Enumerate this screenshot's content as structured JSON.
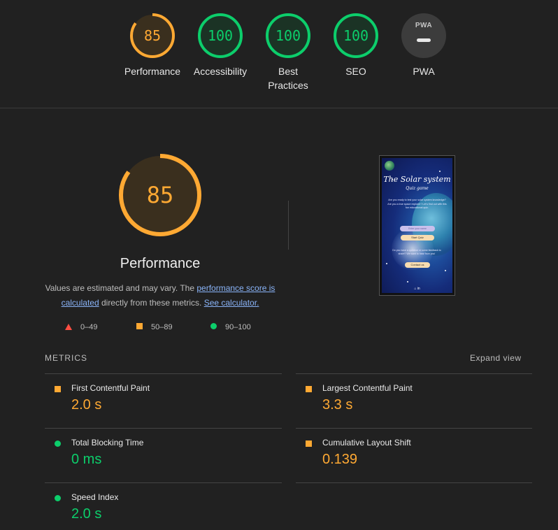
{
  "colors": {
    "background": "#212121",
    "average": "#ffa933",
    "pass": "#0cce6b",
    "fail": "#ff4e42",
    "link": "#8ab4f8"
  },
  "categories": [
    {
      "label": "Performance",
      "score": "85",
      "status": "average"
    },
    {
      "label": "Accessibility",
      "score": "100",
      "status": "pass"
    },
    {
      "label": "Best Practices",
      "score": "100",
      "status": "pass"
    },
    {
      "label": "SEO",
      "score": "100",
      "status": "pass"
    },
    {
      "label": "PWA",
      "score": "",
      "status": "na"
    }
  ],
  "pwa_badge": "PWA",
  "performance": {
    "score": "85",
    "title": "Performance",
    "desc_prefix": "Values are estimated and may vary. The ",
    "desc_link1": "performance score is calculated",
    "desc_middle": " directly from these metrics. ",
    "desc_link2": "See calculator."
  },
  "legend": [
    {
      "icon": "triangle",
      "range": "0–49"
    },
    {
      "icon": "square",
      "range": "50–89"
    },
    {
      "icon": "circle",
      "range": "90–100"
    }
  ],
  "screenshot": {
    "title": "The Solar system",
    "subtitle": "Quiz game",
    "text1": "Are you ready to test your solar system knowledge? Are you a true space explorer? Let's find out with this fun educational quiz.",
    "input_placeholder": "Enter your name",
    "start_button": "Start Quiz",
    "text2": "Do you have a question or some feedback to share? We want to hear from you!",
    "contact_button": "Contact us",
    "footer_icons": "⌂ in"
  },
  "metrics": {
    "title": "METRICS",
    "expand": "Expand view",
    "items": [
      {
        "name": "First Contentful Paint",
        "value": "2.0 s",
        "status": "average"
      },
      {
        "name": "Largest Contentful Paint",
        "value": "3.3 s",
        "status": "average"
      },
      {
        "name": "Total Blocking Time",
        "value": "0 ms",
        "status": "pass"
      },
      {
        "name": "Cumulative Layout Shift",
        "value": "0.139",
        "status": "average"
      },
      {
        "name": "Speed Index",
        "value": "2.0 s",
        "status": "pass"
      }
    ]
  }
}
